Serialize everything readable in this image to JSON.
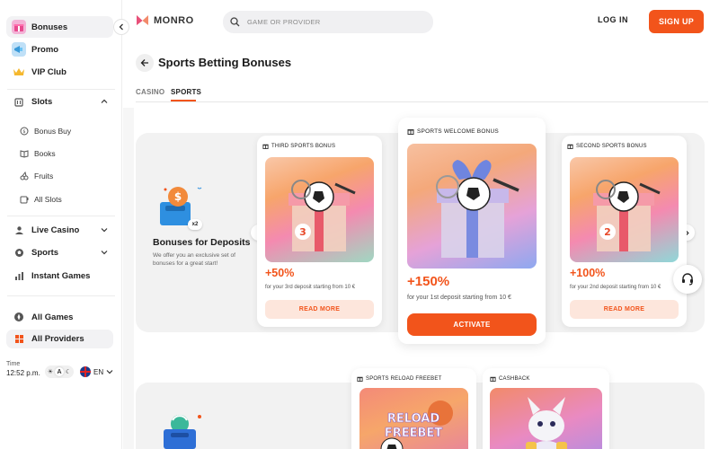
{
  "sidebar": {
    "items": [
      {
        "label": "Bonuses",
        "icon": "gift-icon"
      },
      {
        "label": "Promo",
        "icon": "megaphone-icon"
      },
      {
        "label": "VIP Club",
        "icon": "crown-icon"
      },
      {
        "label": "Slots",
        "icon": "slot-machine-icon"
      },
      {
        "label": "Live Casino",
        "icon": "dealer-icon"
      },
      {
        "label": "Sports",
        "icon": "ball-icon"
      },
      {
        "label": "Instant Games",
        "icon": "chart-icon"
      },
      {
        "label": "All Games",
        "icon": "compass-icon"
      },
      {
        "label": "All Providers",
        "icon": "grid-icon"
      }
    ],
    "slots_sub": [
      {
        "label": "Bonus Buy"
      },
      {
        "label": "Books"
      },
      {
        "label": "Fruits"
      },
      {
        "label": "All Slots"
      }
    ],
    "time_label": "Time",
    "time_value": "12:52 p.m.",
    "theme_label": "A",
    "language": "EN"
  },
  "header": {
    "logo_text": "MONRO",
    "search_placeholder": "GAME OR PROVIDER",
    "login_label": "LOG IN",
    "signup_label": "SIGN UP"
  },
  "page": {
    "title": "Sports Betting Bonuses",
    "tabs": [
      {
        "label": "CASINO",
        "active": false
      },
      {
        "label": "SPORTS",
        "active": true
      }
    ]
  },
  "deposits": {
    "title": "Bonuses for Deposits",
    "description": "We offer you an exclusive set of bonuses for a great start!",
    "badge": "x2",
    "cards": [
      {
        "label": "THIRD SPORTS BONUS",
        "percent": "+50%",
        "desc": "for your 3rd deposit starting from 10 €",
        "button": "READ MORE",
        "number": "3"
      },
      {
        "label": "SPORTS WELCOME BONUS",
        "percent": "+150%",
        "desc": "for your 1st deposit starting from 10 €",
        "button": "ACTIVATE"
      },
      {
        "label": "SECOND SPORTS BONUS",
        "percent": "+100%",
        "desc": "for your 2nd deposit starting from 10 €",
        "button": "READ MORE",
        "number": "2"
      }
    ]
  },
  "second_row": {
    "cards": [
      {
        "label": "SPORTS RELOAD FREEBET",
        "image_text_1": "RELOAD",
        "image_text_2": "FREEBET"
      },
      {
        "label": "CASHBACK"
      }
    ]
  },
  "colors": {
    "accent": "#f2541b",
    "accent_light": "#fde6dc",
    "panel_bg": "#f2f2f2"
  }
}
